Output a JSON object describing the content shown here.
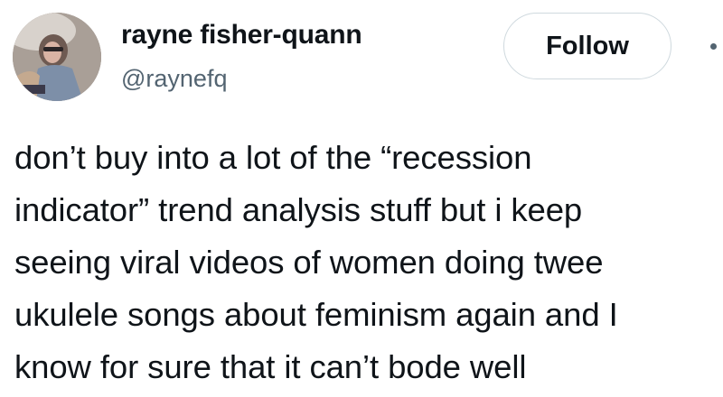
{
  "author": {
    "display_name": "rayne fisher-quann",
    "handle": "@raynefq"
  },
  "follow_button": {
    "label": "Follow"
  },
  "more_icon": "more-dots-icon",
  "tweet": {
    "lines": [
      "don’t buy into a lot of the “recession",
      "indicator” trend analysis stuff but i keep",
      "seeing viral videos of women doing twee",
      "ukulele songs about feminism again and I",
      "know for sure that it can’t bode well"
    ]
  },
  "colors": {
    "text": "#0f1419",
    "secondary": "#536471",
    "button_border": "#cfd9de"
  }
}
